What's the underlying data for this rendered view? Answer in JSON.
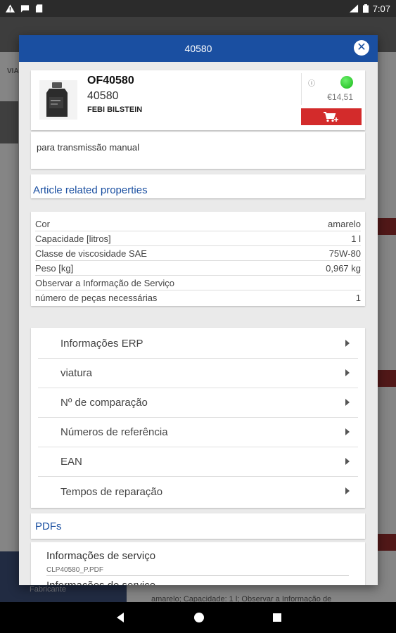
{
  "status_bar": {
    "time": "7:07"
  },
  "background": {
    "tab_label": "VIA",
    "bottom_label": "Fabricante",
    "bottom_text": "amarelo; Capacidade: 1 l; Observar a Informação de"
  },
  "modal": {
    "title": "40580",
    "product": {
      "code": "OF40580",
      "number": "40580",
      "brand": "FEBI BILSTEIN",
      "price": "€14,51",
      "availability_color": "#22c322"
    },
    "description": "para transmissão manual",
    "properties_title": "Article related properties",
    "properties": [
      {
        "name": "Cor",
        "value": "amarelo"
      },
      {
        "name": "Capacidade [litros]",
        "value": "1 l"
      },
      {
        "name": "Classe de viscosidade SAE",
        "value": "75W-80"
      },
      {
        "name": "Peso [kg]",
        "value": "0,967 kg"
      },
      {
        "name": "Observar a Informação de Serviço",
        "value": ""
      },
      {
        "name": "número de peças necessárias",
        "value": "1"
      }
    ],
    "menu": [
      {
        "label": "Informações ERP"
      },
      {
        "label": "viatura"
      },
      {
        "label": "Nº de comparação"
      },
      {
        "label": "Números de referência"
      },
      {
        "label": "EAN"
      },
      {
        "label": "Tempos de reparação"
      }
    ],
    "pdfs_title": "PDFs",
    "pdfs": [
      {
        "title": "Informações de serviço",
        "file": "CLP40580_P.PDF"
      },
      {
        "title": "Informações de serviço",
        "file": ""
      }
    ]
  },
  "colors": {
    "header": "#1a4fa1",
    "accent_red": "#d32b2b",
    "link_blue": "#1a4fa1"
  }
}
